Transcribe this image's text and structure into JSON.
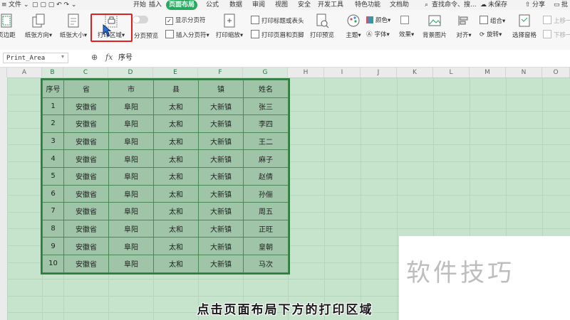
{
  "menu": {
    "file_label": "文件",
    "items": [
      "开始",
      "插入",
      "页面布局",
      "公式",
      "数据",
      "审阅",
      "视图",
      "安全",
      "开发工具",
      "特色功能",
      "文档助"
    ],
    "active_index": 2,
    "search_label": "查找命令、搜...",
    "unsaved_label": "未保存",
    "share_label": "分享",
    "comment_label": "批"
  },
  "ribbon": {
    "margins": "页边距",
    "orientation": "纸张方向",
    "size": "纸张大小",
    "print_area": "打印区域",
    "page_break_preview": "分页预览",
    "show_page_breaks": "显示分页符",
    "insert_page_break": "插入分页符",
    "print_scale": "打印缩放",
    "print_titles": "打印标题或表头",
    "print_header_footer": "打印页眉和页脚",
    "print_preview": "打印预览",
    "theme": "主题",
    "colors": "颜色",
    "fonts": "字体",
    "effects": "效果",
    "background": "背景图片",
    "align": "对齐",
    "group": "组合",
    "rotate": "旋转",
    "selection_pane": "选择窗格",
    "bring_forward": "上移一",
    "send_backward": "下移一"
  },
  "formula_bar": {
    "name_box": "Print_Area",
    "fx": "fx",
    "value": "序号"
  },
  "columns": [
    "A",
    "B",
    "C",
    "D",
    "E",
    "F",
    "G",
    "H",
    "I",
    "J",
    "K",
    "L",
    "M",
    "N",
    "O"
  ],
  "table": {
    "headers": [
      "序号",
      "省",
      "市",
      "县",
      "镇",
      "姓名"
    ],
    "rows": [
      [
        "1",
        "安徽省",
        "阜阳",
        "太和",
        "大新镇",
        "张三"
      ],
      [
        "2",
        "安徽省",
        "阜阳",
        "太和",
        "大新镇",
        "李四"
      ],
      [
        "3",
        "安徽省",
        "阜阳",
        "太和",
        "大新镇",
        "王二"
      ],
      [
        "4",
        "安徽省",
        "阜阳",
        "太和",
        "大新镇",
        "麻子"
      ],
      [
        "5",
        "安徽省",
        "阜阳",
        "太和",
        "大新镇",
        "赵倩"
      ],
      [
        "6",
        "安徽省",
        "阜阳",
        "太和",
        "大新镇",
        "孙俪"
      ],
      [
        "7",
        "安徽省",
        "阜阳",
        "太和",
        "大新镇",
        "周五"
      ],
      [
        "8",
        "安徽省",
        "阜阳",
        "太和",
        "大新镇",
        "正旺"
      ],
      [
        "9",
        "安徽省",
        "阜阳",
        "太和",
        "大新镇",
        "皇朝"
      ],
      [
        "10",
        "安徽省",
        "阜阳",
        "太和",
        "大新镇",
        "马次"
      ]
    ]
  },
  "watermark": "软件技巧",
  "subtitle": "点击页面布局下方的打印区域",
  "colors": {
    "accent_green": "#27a95f",
    "highlight_red": "#e02020",
    "sheet_bg": "#c6e3cc",
    "table_fill": "#9fc4a7"
  }
}
